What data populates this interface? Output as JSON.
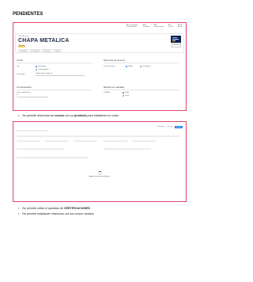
{
  "heading": "PENDIENTES",
  "shot1": {
    "top_stats": [
      {
        "num": "0",
        "label": "Estudiantes",
        "sub": "0 matriculados"
      },
      {
        "num": "0",
        "label": "Unidades",
        "sub": ""
      },
      {
        "num": "0",
        "label": "Evaluaciones",
        "sub": ""
      },
      {
        "num": "0",
        "label": "Temas",
        "sub": ""
      },
      {
        "num": "0",
        "label": "Ver",
        "sub": "detalle"
      }
    ],
    "course_label": "Título del curso",
    "course_title": "CHAPA METALICA",
    "badge": "Borrador",
    "tabs": [
      "Contenido",
      "Descripción",
      "Opciones",
      "Grupos"
    ],
    "card_button": "Opciones",
    "curso": {
      "title": "Curso",
      "tipo_label": "Tipo",
      "opt_online": "Curso online",
      "opt_presencial": "Curso presencial",
      "responsable_label": "Responsable",
      "responsable_value": "Catalán Garcia, Jorge Luis"
    },
    "acceso": {
      "title": "Permisos de acceso",
      "politica_label": "Política de registro",
      "opt_publico": "Público",
      "opt_privado": "Por invitación"
    },
    "comunicacion": {
      "title": "Comunicación",
      "notif_label": "Permitir notificaciones",
      "notif_value": "Sí"
    },
    "mostrar": {
      "title": "Mostrar en pantalla",
      "visibilidad_label": "Visibilidad",
      "opt_visible": "Visible",
      "opt_oculto": "Oculto"
    }
  },
  "bullet1": {
    "before": "No permite relacionar los ",
    "b1": "cursos",
    "mid": " con un ",
    "b2": "producto",
    "after": " para establecer un costo."
  },
  "shot2": {
    "top_links": [
      "Vista previa",
      "Cancelar"
    ],
    "save": "Guardar",
    "loading_text": "Agregar una nueva certificación"
  },
  "bullet2": {
    "before": "No permite editar el apartado de ",
    "b1": "CERTIFICACIONES"
  },
  "bullet3": {
    "text": "No permite establecer relaciones con los cursos creados"
  }
}
